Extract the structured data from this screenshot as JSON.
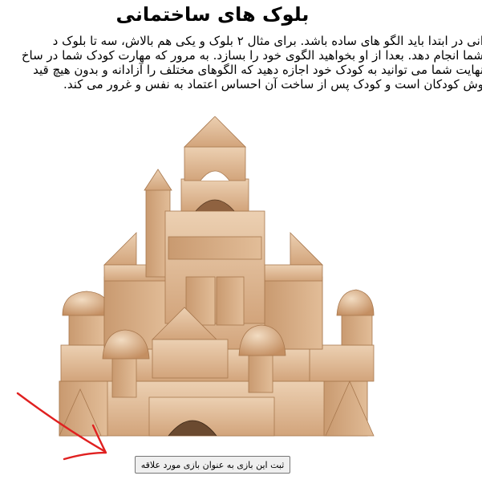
{
  "title": "بلوک های ساختمانی",
  "paragraph_lines": [
    "انی در ابتدا باید الگو های ساده باشد. برای مثال ۲ بلوک و یکی هم بالاش، سه تا بلوک د",
    "شما انجام دهد. بعدا از او بخواهید الگوی خود را بسازد. به مرور که مهارت کودک شما در ساخ",
    "نهایت شما می توانید به کودک خود اجازه دهید که الگوهای مختلف را آزادانه و بدون هیچ قید",
    "وش کودکان است و کودک پس از ساخت آن احساس اعتماد به نفس و غرور می کند."
  ],
  "favorite_button_label": "ثبت این بازی به عنوان بازی مورد علاقه",
  "icons": {
    "illustration": "wooden-building-blocks-image",
    "arrow": "red-hand-drawn-arrow-icon"
  },
  "colors": {
    "background": "#ffffff",
    "wood_light": "#e6c3a0",
    "wood_mid": "#d4a77e",
    "wood_dark": "#b98559",
    "arrow": "#e02020",
    "button_bg": "#efefef",
    "button_border": "#767676"
  }
}
